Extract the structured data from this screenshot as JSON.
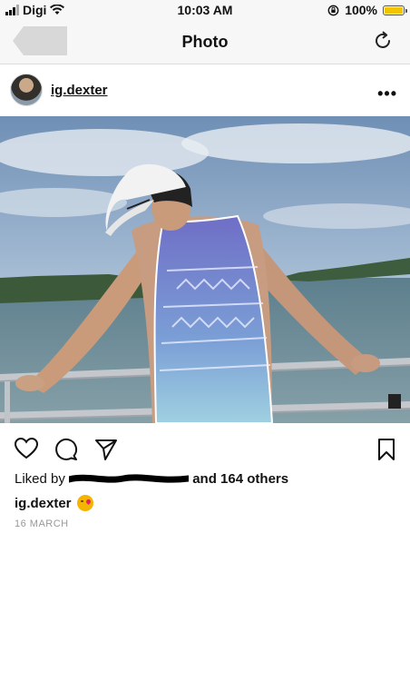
{
  "status_bar": {
    "carrier": "Digi",
    "time": "10:03 AM",
    "battery_percent": "100%",
    "battery_level": 1.0,
    "battery_color": "#f5c400"
  },
  "nav": {
    "title": "Photo",
    "icons": [
      "back-arrow-icon",
      "refresh-icon"
    ]
  },
  "post": {
    "username": "ig.dexter",
    "more_icon": "more-options-icon",
    "actions": [
      "heart-icon",
      "comment-icon",
      "share-icon",
      "bookmark-icon"
    ],
    "likes_prefix": "Liked by",
    "likes_suffix": "and 164 others",
    "caption_user": "ig.dexter",
    "caption_emoji": "kissing-face-emoji",
    "date": "16 MARCH"
  }
}
